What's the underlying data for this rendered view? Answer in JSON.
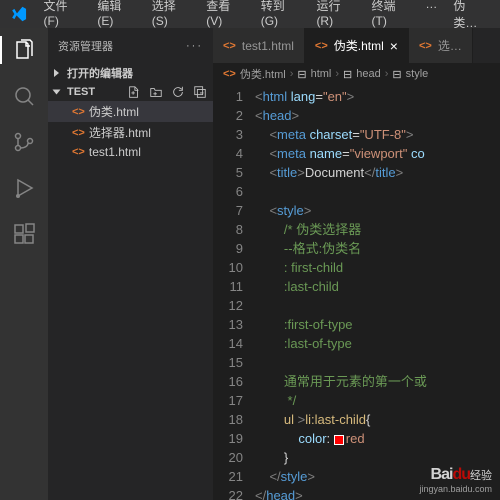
{
  "menubar": {
    "items": [
      "文件(F)",
      "编辑(E)",
      "选择(S)",
      "查看(V)",
      "转到(G)",
      "运行(R)",
      "终端(T)",
      "…",
      "伪类…"
    ]
  },
  "sidebar": {
    "title": "资源管理器",
    "open_editors": "打开的编辑器",
    "folder": "TEST",
    "files": [
      {
        "name": "伪类.html",
        "selected": true
      },
      {
        "name": "选择器.html",
        "selected": false
      },
      {
        "name": "test1.html",
        "selected": false
      }
    ]
  },
  "tabs": [
    {
      "name": "test1.html",
      "active": false
    },
    {
      "name": "伪类.html",
      "active": true
    },
    {
      "name": "选…",
      "active": false
    }
  ],
  "breadcrumbs": [
    "伪类.html",
    "html",
    "head",
    "style"
  ],
  "code": {
    "lines": 22,
    "content": [
      {
        "n": 1,
        "html": "<span class='c-brkt'>&lt;</span><span class='c-tag'>html</span> <span class='c-attr'>lang</span><span class='c-txt'>=</span><span class='c-str'>\"en\"</span><span class='c-brkt'>&gt;</span>"
      },
      {
        "n": 2,
        "html": "<span class='c-brkt'>&lt;</span><span class='c-tag'>head</span><span class='c-brkt'>&gt;</span>"
      },
      {
        "n": 3,
        "html": "    <span class='c-brkt'>&lt;</span><span class='c-tag'>meta</span> <span class='c-attr'>charset</span><span class='c-txt'>=</span><span class='c-str'>\"UTF-8\"</span><span class='c-brkt'>&gt;</span>"
      },
      {
        "n": 4,
        "html": "    <span class='c-brkt'>&lt;</span><span class='c-tag'>meta</span> <span class='c-attr'>name</span><span class='c-txt'>=</span><span class='c-str'>\"viewport\"</span> <span class='c-attr'>co</span>"
      },
      {
        "n": 5,
        "html": "    <span class='c-brkt'>&lt;</span><span class='c-tag'>title</span><span class='c-brkt'>&gt;</span><span class='c-txt'>Document</span><span class='c-brkt'>&lt;/</span><span class='c-tag'>title</span><span class='c-brkt'>&gt;</span>"
      },
      {
        "n": 6,
        "html": ""
      },
      {
        "n": 7,
        "html": "    <span class='c-brkt'>&lt;</span><span class='c-tag'>style</span><span class='c-brkt'>&gt;</span>"
      },
      {
        "n": 8,
        "html": "        <span class='c-com'>/* 伪类选择器</span>"
      },
      {
        "n": 9,
        "html": "        <span class='c-com'>--格式:伪类名</span>"
      },
      {
        "n": 10,
        "html": "        <span class='c-com'>: first-child</span>"
      },
      {
        "n": 11,
        "html": "        <span class='c-com'>:last-child</span>"
      },
      {
        "n": 12,
        "html": ""
      },
      {
        "n": 13,
        "html": "        <span class='c-com'>:first-of-type</span>"
      },
      {
        "n": 14,
        "html": "        <span class='c-com'>:last-of-type</span>"
      },
      {
        "n": 15,
        "html": ""
      },
      {
        "n": 16,
        "html": "        <span class='c-com'>通常用于元素的第一个或</span>"
      },
      {
        "n": 17,
        "html": "         <span class='c-com'>*/</span>"
      },
      {
        "n": 18,
        "html": "        <span class='c-sel'>ul</span> <span class='c-brkt'>&gt;</span><span class='c-sel'>li:last-child</span><span class='c-txt'>{</span>"
      },
      {
        "n": 19,
        "html": "            <span class='c-prop'>color</span><span class='c-txt'>:</span> <span class='c-red-box'></span><span class='c-val'>red</span>"
      },
      {
        "n": 20,
        "html": "        <span class='c-txt'>}</span>"
      },
      {
        "n": 21,
        "html": "    <span class='c-brkt'>&lt;/</span><span class='c-tag'>style</span><span class='c-brkt'>&gt;</span>"
      },
      {
        "n": 22,
        "html": "<span class='c-brkt'>&lt;/</span><span class='c-tag'>head</span><span class='c-brkt'>&gt;</span>"
      }
    ]
  },
  "watermark": {
    "brand": "Bai",
    "brand2": "du",
    "sub": "经验",
    "url": "jingyan.baidu.com"
  }
}
